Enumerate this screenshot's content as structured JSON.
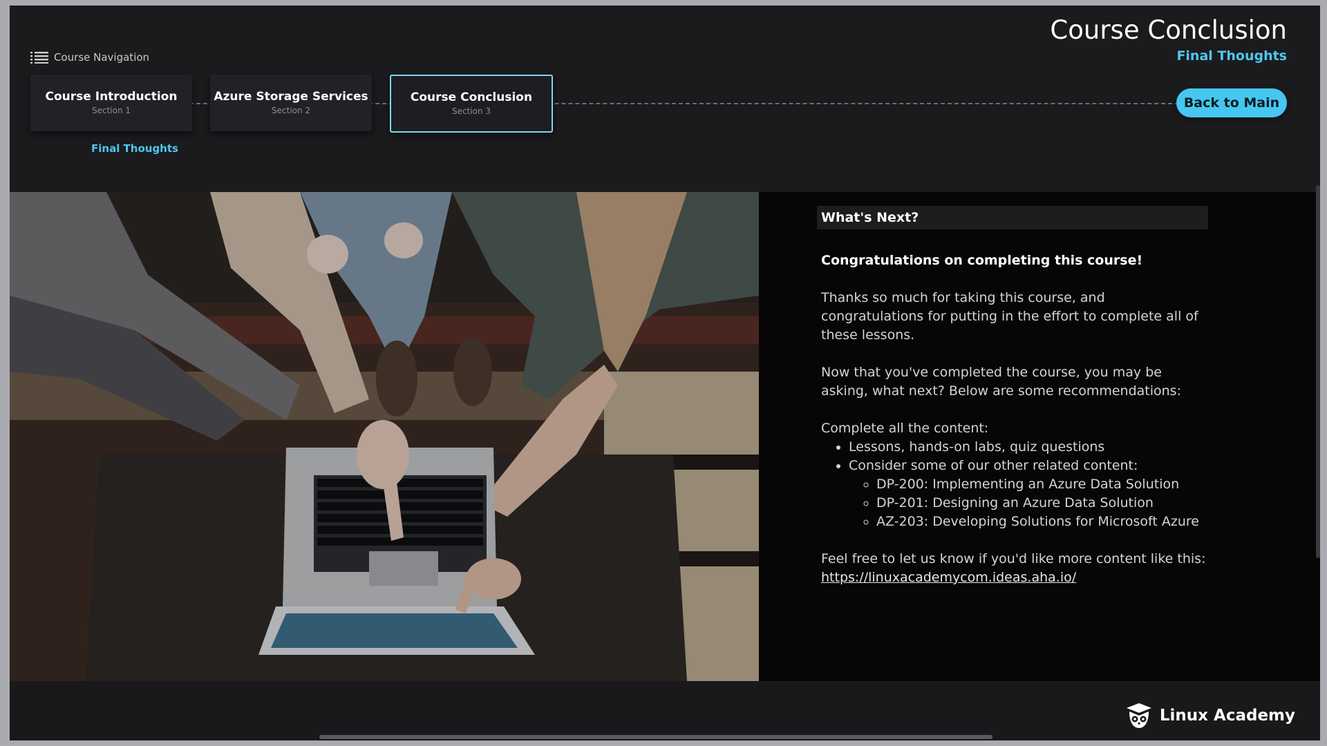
{
  "header": {
    "title": "Course Conclusion",
    "subtitle": "Final Thoughts",
    "nav_label": "Course Navigation",
    "back_button": "Back to Main"
  },
  "sections": [
    {
      "name": "Course Introduction",
      "num": "Section 1"
    },
    {
      "name": "Azure Storage Services",
      "num": "Section 2"
    },
    {
      "name": "Course Conclusion",
      "num": "Section 3"
    }
  ],
  "active_section_item": "Final Thoughts",
  "content": {
    "heading": "What's Next?",
    "congrats": "Congratulations on completing this course!",
    "para1": "Thanks so much for taking this course, and congratulations for putting in the effort to complete all of these lessons.",
    "para2": "Now that you've completed the course, you may be asking, what next? Below are some recommendations:",
    "list_intro": "Complete all the content:",
    "bullets": [
      "Lessons, hands-on labs, quiz questions",
      "Consider some of our other related content:"
    ],
    "sub_bullets": [
      "DP-200: Implementing an Azure Data Solution",
      "DP-201: Designing an Azure Data Solution",
      "AZ-203: Developing Solutions for Microsoft Azure"
    ],
    "feedback": "Feel free to let us know if you'd like more content like this:",
    "link": "https://linuxacademycom.ideas.aha.io/"
  },
  "footer": {
    "brand": "Linux Academy"
  },
  "colors": {
    "accent": "#4fc7ee",
    "button": "#45c7f0",
    "background": "#1a1a1d"
  },
  "icons": [
    "list-icon",
    "owl-logo-icon"
  ]
}
